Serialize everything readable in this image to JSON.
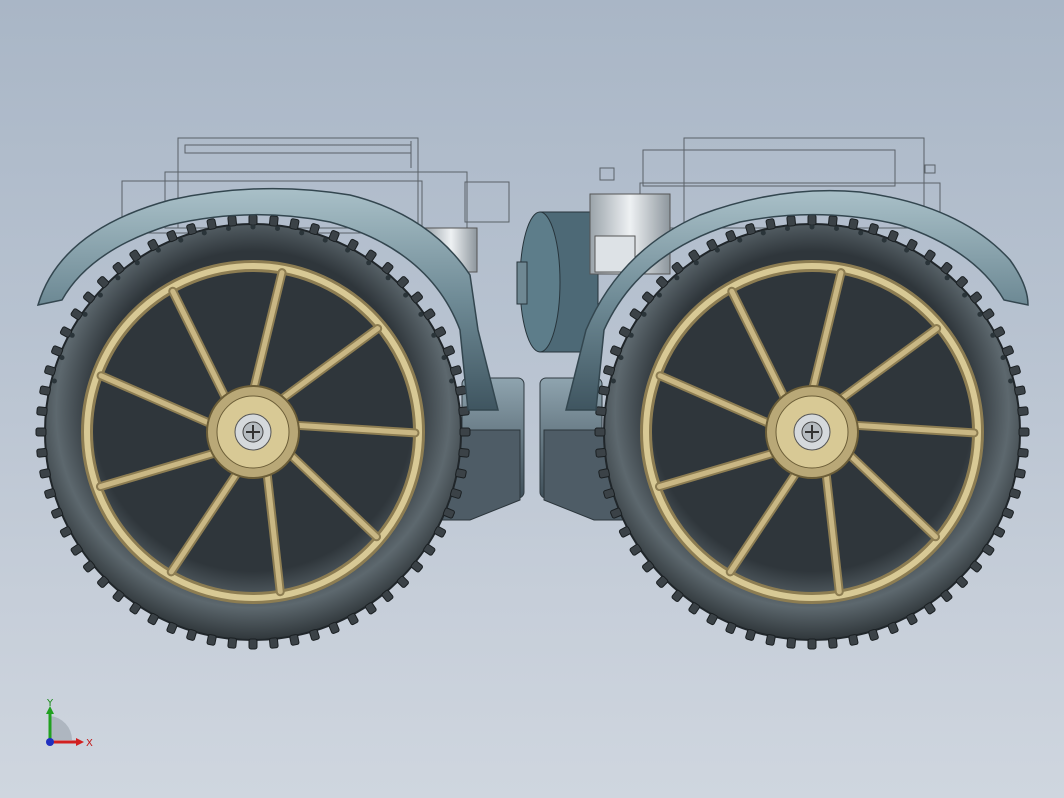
{
  "viewport": {
    "background_top": "#a9b6c6",
    "background_bottom": "#cfd6df"
  },
  "model": {
    "wheel_count": 2,
    "spokes_per_wheel": 9,
    "colors": {
      "tire": "#3b4247",
      "tire_highlight": "#5b656b",
      "rim_gold": "#c9b784",
      "rim_gold_dark": "#8d7d52",
      "fender": "#7f99a4",
      "fender_dark": "#4f6a75",
      "hub_green": "#c4d48f",
      "hub_green_dark": "#8ea15a",
      "body_dark": "#4f5d68",
      "wire": "#55606a",
      "metal": "#cfd5da"
    }
  },
  "triad": {
    "x_label": "X",
    "y_label": "Y",
    "x_color": "#d22020",
    "y_color": "#20a020",
    "z_color": "#2030c0"
  }
}
